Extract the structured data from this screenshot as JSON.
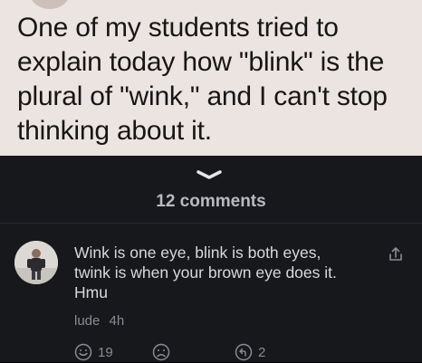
{
  "post": {
    "text": "One of my students tried to explain today how \"blink\" is the plural of \"wink,\" and I can't stop thinking about it."
  },
  "comments": {
    "count_label": "12 comments"
  },
  "comment": {
    "text": "Wink is one eye, blink is both eyes, twink is when your brown eye does it. Hmu",
    "author": "lude",
    "time": "4h",
    "like_count": "19",
    "reply_count": "2"
  },
  "icons": {
    "handle": "chevron-down-icon",
    "share": "share-icon",
    "like": "smile-icon",
    "dislike": "frown-icon",
    "reply": "reply-icon"
  },
  "colors": {
    "post_bg": "#ece4e1",
    "sheet_bg": "#17181c",
    "text_light": "#d8d9dd",
    "text_muted": "#8a8b91"
  }
}
